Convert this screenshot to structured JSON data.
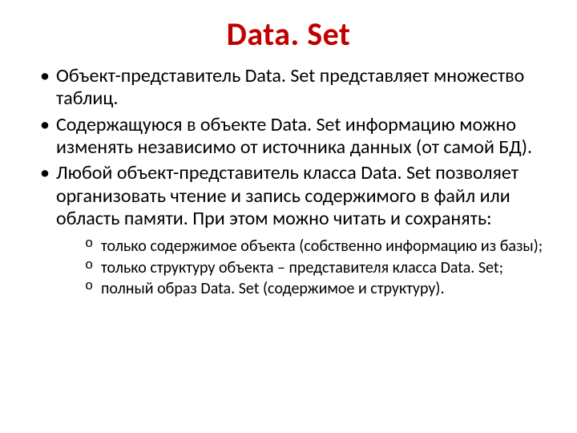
{
  "title": "Data. Set",
  "bullets": [
    "Объект-представитель Data. Set представляет множество таблиц.",
    "Содержащуюся в объекте Data. Set информацию можно изменять независимо от источника данных (от самой БД).",
    "Любой объект-представитель класса Data. Set позволяет организовать чтение и запись содержимого в файл или область памяти. При этом можно читать и сохранять:"
  ],
  "subbullets": [
    "только содержимое объекта (собственно информацию из базы);",
    "только структуру объекта – представителя класса Data. Set;",
    "полный образ Data. Set (содержимое и структуру)."
  ]
}
